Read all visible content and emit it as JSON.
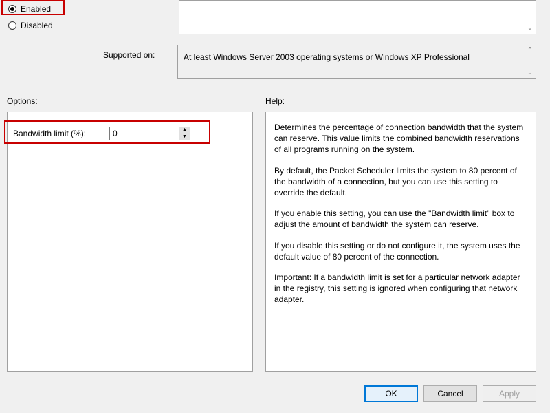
{
  "radios": {
    "enabled": "Enabled",
    "disabled": "Disabled"
  },
  "supported": {
    "label": "Supported on:",
    "text": "At least Windows Server 2003 operating systems or Windows XP Professional"
  },
  "sections": {
    "options": "Options:",
    "help": "Help:"
  },
  "options": {
    "bandwidth_label": "Bandwidth limit (%):",
    "bandwidth_value": "0"
  },
  "help": {
    "p1": "Determines the percentage of connection bandwidth that the system can reserve. This value limits the combined bandwidth reservations of all programs running on the system.",
    "p2": "By default, the Packet Scheduler limits the system to 80 percent of the bandwidth of a connection, but you can use this setting to override the default.",
    "p3": "If you enable this setting, you can use the \"Bandwidth limit\" box to adjust the amount of bandwidth the system can reserve.",
    "p4": "If you disable this setting or do not configure it, the system uses the default value of 80 percent of the connection.",
    "p5": "Important: If a bandwidth limit is set for a particular network adapter in the registry, this setting is ignored when configuring that network adapter."
  },
  "buttons": {
    "ok": "OK",
    "cancel": "Cancel",
    "apply": "Apply"
  }
}
